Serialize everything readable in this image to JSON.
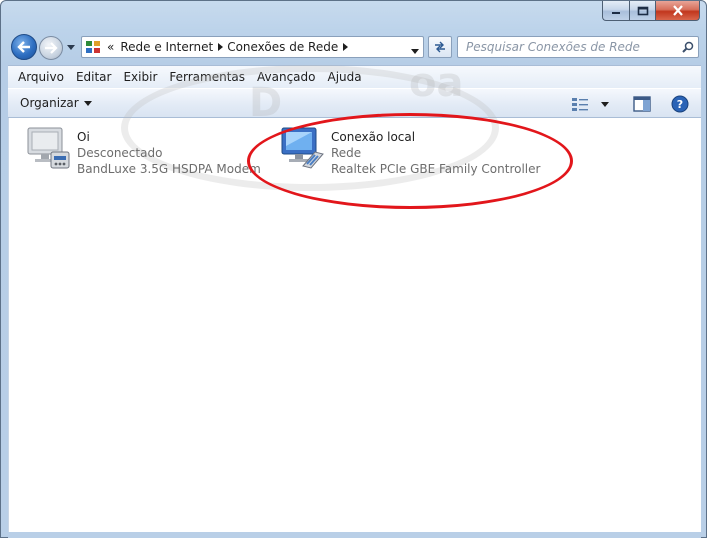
{
  "address_bar": {
    "overflow": "«",
    "segments": [
      "Rede e Internet",
      "Conexões de Rede"
    ]
  },
  "search": {
    "placeholder": "Pesquisar Conexões de Rede"
  },
  "menubar": {
    "items": [
      "Arquivo",
      "Editar",
      "Exibir",
      "Ferramentas",
      "Avançado",
      "Ajuda"
    ]
  },
  "commandbar": {
    "organize": "Organizar"
  },
  "connections": [
    {
      "name": "Oi",
      "status": "Desconectado",
      "device": "BandLuxe 3.5G HSDPA Modem",
      "icon": "modem-connection-icon"
    },
    {
      "name": "Conexão local",
      "status": "Rede",
      "device": "Realtek PCIe GBE Family Controller",
      "icon": "lan-connection-icon"
    }
  ],
  "colors": {
    "highlight": "#e2161b",
    "accent": "#2e6fc2"
  }
}
